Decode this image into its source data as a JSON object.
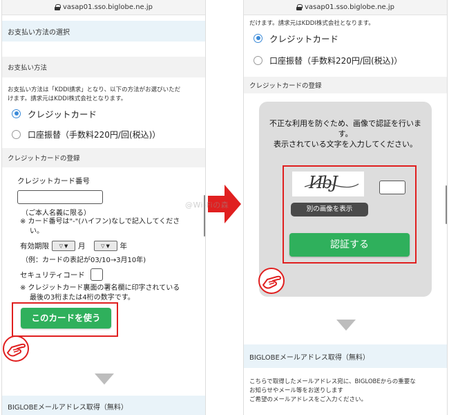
{
  "url": "vasap01.sso.biglobe.ne.jp",
  "watermark": "@Wi-Fiの森",
  "left": {
    "section_title": "お支払い方法の選択",
    "payment_heading": "お支払い方法",
    "payment_note_1": "お支払い方法は「KDDI請求」となり、以下の方法がお選びいただ",
    "payment_note_2": "けます。請求元はKDDI株式会社となります。",
    "option_credit": "クレジットカード",
    "option_bank": "口座振替（手数料220円/回(税込)）",
    "card_reg_heading": "クレジットカードの登録",
    "card_number_label": "クレジットカード番号",
    "card_number_value": "",
    "own_name_note": "（ご本人名義に限る）",
    "hyphen_note_1": "※ カード番号は\"-\"(ハイフン)なしで記入してくださ",
    "hyphen_note_2": "い。",
    "expiry_label": "有効期限",
    "month_label": "月",
    "year_label": "年",
    "expiry_example": "（例：カードの表記が03/10→3月10年)",
    "security_label": "セキュリティコード",
    "security_note_1": "※ クレジットカード裏面の署名欄に印字されている",
    "security_note_2": "最後の3桁または4桁の数字です。",
    "use_card_button": "このカードを使う",
    "next_section": "BIGLOBEメールアドレス取得（無料）"
  },
  "right": {
    "top_note": "だけます。請求元はKDDI株式会社となります。",
    "option_credit": "クレジットカード",
    "option_bank": "口座振替（手数料220円/回(税込)）",
    "card_reg_heading": "クレジットカードの登録",
    "modal_line_1": "不正な利用を防ぐため、画像で認証を行いま",
    "modal_line_2": "す。",
    "modal_line_3": "表示されている文字を入力してください。",
    "captcha_text": "ИbJ",
    "captcha_input": "",
    "other_image_button": "別の画像を表示",
    "verify_button": "認証する",
    "next_section": "BIGLOBEメールアドレス取得（無料）",
    "mail_note_1": "こちらで取得したメールアドレス宛に、BIGLOBEからの重要な",
    "mail_note_2": "お知らせやメール等をお送りします",
    "mail_note_3": "ご希望のメールアドレスをご入力ください。"
  },
  "colors": {
    "accent_red": "#e02020",
    "button_green": "#2fb05c",
    "radio_blue": "#3a8ad8",
    "band_blue": "#e9f3f9"
  }
}
